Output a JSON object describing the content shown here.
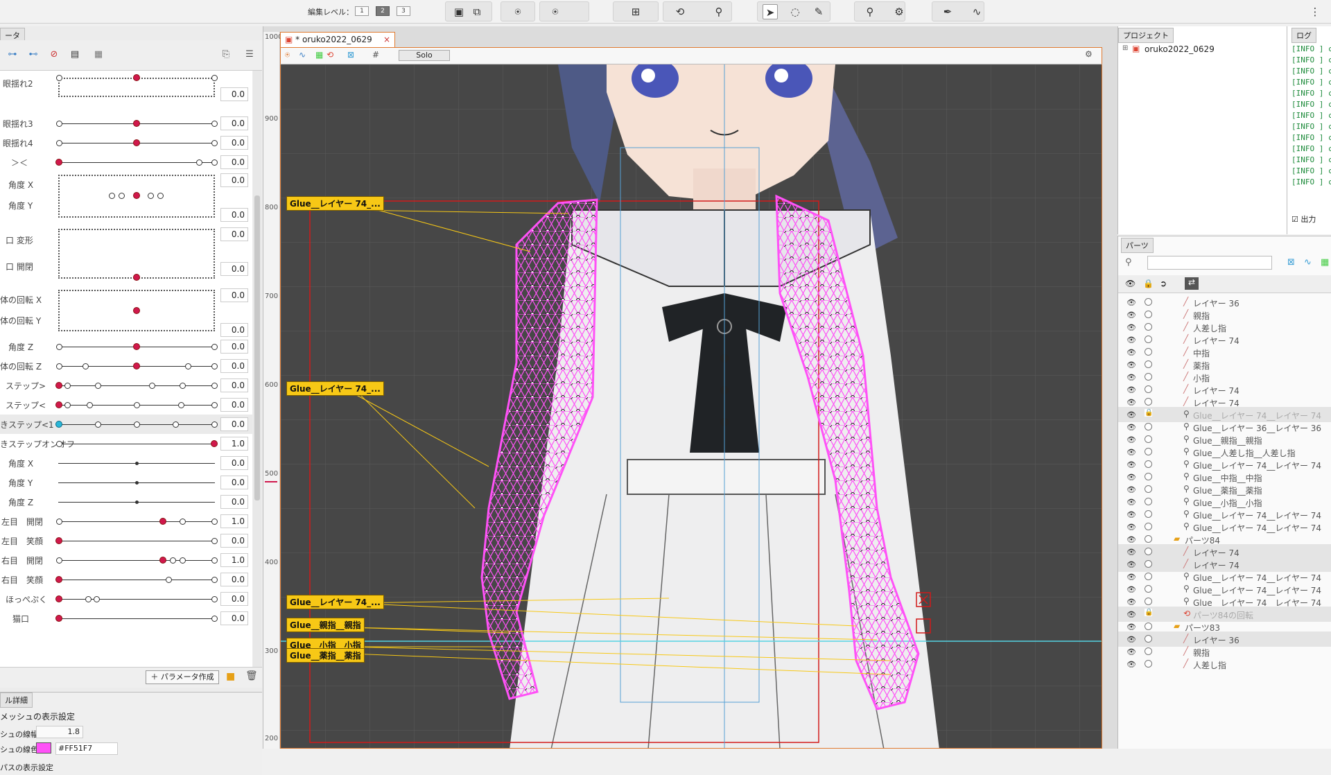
{
  "toolbar": {
    "edit_level_label": "編集レベル：",
    "levels": [
      "1",
      "2",
      "3"
    ],
    "active_level": "2"
  },
  "left": {
    "tab_label": "ータ",
    "create_param_label": "パラメータ作成",
    "params": [
      {
        "label": "眼揺れ2",
        "value": "0.0"
      },
      {
        "label": "眼揺れ3",
        "value": "0.0"
      },
      {
        "label": "眼揺れ4",
        "value": "0.0"
      },
      {
        "label": "＞＜",
        "value": "0.0"
      },
      {
        "label": "角度 X",
        "value": "0.0"
      },
      {
        "label": "角度 Y",
        "value": "0.0"
      },
      {
        "label": "口 変形",
        "value": "0.0"
      },
      {
        "label": "口 開閉",
        "value": "0.0"
      },
      {
        "label": "体の回転 X",
        "value": "0.0"
      },
      {
        "label": "体の回転 Y",
        "value": "0.0"
      },
      {
        "label": "角度 Z",
        "value": "0.0"
      },
      {
        "label": "体の回転 Z",
        "value": "0.0"
      },
      {
        "label": "ステップ>",
        "value": "0.0"
      },
      {
        "label": "ステップ<",
        "value": "0.0"
      },
      {
        "label": "きステップ<1",
        "value": "0.0"
      },
      {
        "label": "きステップオンオフ",
        "value": "1.0"
      },
      {
        "label": "角度 X",
        "value": "0.0"
      },
      {
        "label": "角度 Y",
        "value": "0.0"
      },
      {
        "label": "角度 Z",
        "value": "0.0"
      },
      {
        "label": "左目　開閉",
        "value": "1.0"
      },
      {
        "label": "左目　笑顔",
        "value": "0.0"
      },
      {
        "label": "右目　開閉",
        "value": "1.0"
      },
      {
        "label": "右目　笑顔",
        "value": "0.0"
      },
      {
        "label": "ほっぺぷく",
        "value": "0.0"
      },
      {
        "label": "猫口",
        "value": "0.0"
      }
    ],
    "detail": {
      "tab_label": "ル詳細",
      "mesh_header": "メッシュの表示設定",
      "line_width_label": "シュの線幅",
      "line_width_value": "1.8",
      "line_color_label": "シュの線色",
      "line_color_value": "#FF51F7",
      "path_header": "パスの表示設定"
    }
  },
  "canvas": {
    "doc_title": "* oruko2022_0629",
    "solo_label": "Solo",
    "ruler_ticks": [
      "1000",
      "900",
      "800",
      "700",
      "600",
      "500",
      "400",
      "300",
      "200"
    ],
    "glue_labels": [
      "Glue__レイヤー 74_...",
      "Glue__レイヤー 74_...",
      "Glue__レイヤー 74_...",
      "Glue__親指__親指",
      "Glue__小指__小指",
      "Glue__薬指__薬指"
    ],
    "mesh_color": "#FF51F7"
  },
  "project": {
    "tab_label": "プロジェクト",
    "file_name": "oruko2022_0629"
  },
  "log": {
    "tab_label": "ログ",
    "lines": [
      "[INFO ] cr",
      "[INFO ] cr",
      "[INFO ] cr",
      "[INFO ] cr",
      "[INFO ] cr",
      "[INFO ] cr",
      "[INFO ] cr",
      "[INFO ] cr",
      "[INFO ] cr",
      "[INFO ] cr",
      "[INFO ] cr",
      "[INFO ] cr",
      "[INFO ] cr"
    ],
    "output_label": "出力"
  },
  "parts": {
    "tab_label": "パーツ",
    "rows": [
      {
        "name": "レイヤー 36",
        "indent": 1,
        "icon": "brush",
        "dim": false
      },
      {
        "name": "親指",
        "indent": 1,
        "icon": "brush",
        "dim": false
      },
      {
        "name": "人差し指",
        "indent": 1,
        "icon": "brush",
        "dim": false
      },
      {
        "name": "レイヤー 74",
        "indent": 1,
        "icon": "brush",
        "dim": false
      },
      {
        "name": "中指",
        "indent": 1,
        "icon": "brush",
        "dim": false
      },
      {
        "name": "薬指",
        "indent": 1,
        "icon": "brush",
        "dim": false
      },
      {
        "name": "小指",
        "indent": 1,
        "icon": "brush",
        "dim": false
      },
      {
        "name": "レイヤー 74",
        "indent": 1,
        "icon": "brush",
        "dim": false
      },
      {
        "name": "レイヤー 74",
        "indent": 1,
        "icon": "brush",
        "dim": false
      },
      {
        "name": "Glue__レイヤー 74__レイヤー 74",
        "indent": 1,
        "icon": "glue",
        "dim": true
      },
      {
        "name": "Glue__レイヤー 36__レイヤー 36",
        "indent": 1,
        "icon": "glue",
        "dim": false
      },
      {
        "name": "Glue__親指__親指",
        "indent": 1,
        "icon": "glue",
        "dim": false
      },
      {
        "name": "Glue__人差し指__人差し指",
        "indent": 1,
        "icon": "glue",
        "dim": false
      },
      {
        "name": "Glue__レイヤー 74__レイヤー 74",
        "indent": 1,
        "icon": "glue",
        "dim": false
      },
      {
        "name": "Glue__中指__中指",
        "indent": 1,
        "icon": "glue",
        "dim": false
      },
      {
        "name": "Glue__薬指__薬指",
        "indent": 1,
        "icon": "glue",
        "dim": false
      },
      {
        "name": "Glue__小指__小指",
        "indent": 1,
        "icon": "glue",
        "dim": false
      },
      {
        "name": "Glue__レイヤー 74__レイヤー 74",
        "indent": 1,
        "icon": "glue",
        "dim": false
      },
      {
        "name": "Glue__レイヤー 74__レイヤー 74",
        "indent": 1,
        "icon": "glue",
        "dim": false
      },
      {
        "name": "パーツ84",
        "indent": 0,
        "icon": "folder",
        "dim": false
      },
      {
        "name": "レイヤー 74",
        "indent": 1,
        "icon": "brush",
        "dim": false
      },
      {
        "name": "レイヤー 74",
        "indent": 1,
        "icon": "brush",
        "dim": false
      },
      {
        "name": "Glue__レイヤー 74__レイヤー 74",
        "indent": 1,
        "icon": "glue",
        "dim": false
      },
      {
        "name": "Glue__レイヤー 74__レイヤー 74",
        "indent": 1,
        "icon": "glue",
        "dim": false
      },
      {
        "name": "Glue__レイヤー 74__レイヤー 74",
        "indent": 1,
        "icon": "glue",
        "dim": false
      },
      {
        "name": "パーツ84の回転",
        "indent": 1,
        "icon": "rotate",
        "dim": true
      },
      {
        "name": "パーツ83",
        "indent": 0,
        "icon": "folder",
        "dim": false
      },
      {
        "name": "レイヤー 36",
        "indent": 1,
        "icon": "brush",
        "dim": false
      },
      {
        "name": "親指",
        "indent": 1,
        "icon": "brush",
        "dim": false
      },
      {
        "name": "人差し指",
        "indent": 1,
        "icon": "brush",
        "dim": false
      }
    ]
  }
}
